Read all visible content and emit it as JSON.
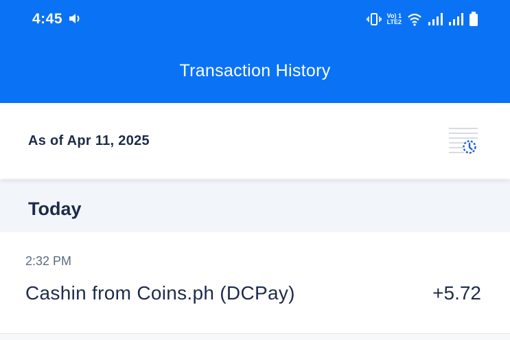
{
  "status_bar": {
    "time": "4:45",
    "lte_top": "Vo) 1",
    "lte_bottom": "LTE2",
    "icons": [
      "speaker-icon",
      "vibrate-icon",
      "volte-icon",
      "wifi-icon",
      "signal-icon",
      "signal-icon",
      "battery-icon"
    ]
  },
  "header": {
    "title": "Transaction History"
  },
  "as_of": {
    "label": "As of Apr 11, 2025"
  },
  "filter": {
    "icon": "history-filter-icon",
    "accent": "#1d5ed8"
  },
  "sections": [
    {
      "title": "Today",
      "transactions": [
        {
          "time": "2:32 PM",
          "description": "Cashin from Coins.ph (DCPay)",
          "amount": "+5.72"
        }
      ]
    }
  ],
  "colors": {
    "primary": "#0a73f5",
    "text_dark": "#1d2b4a",
    "text_muted": "#5a6a85",
    "section_bg": "#f2f5fa"
  }
}
